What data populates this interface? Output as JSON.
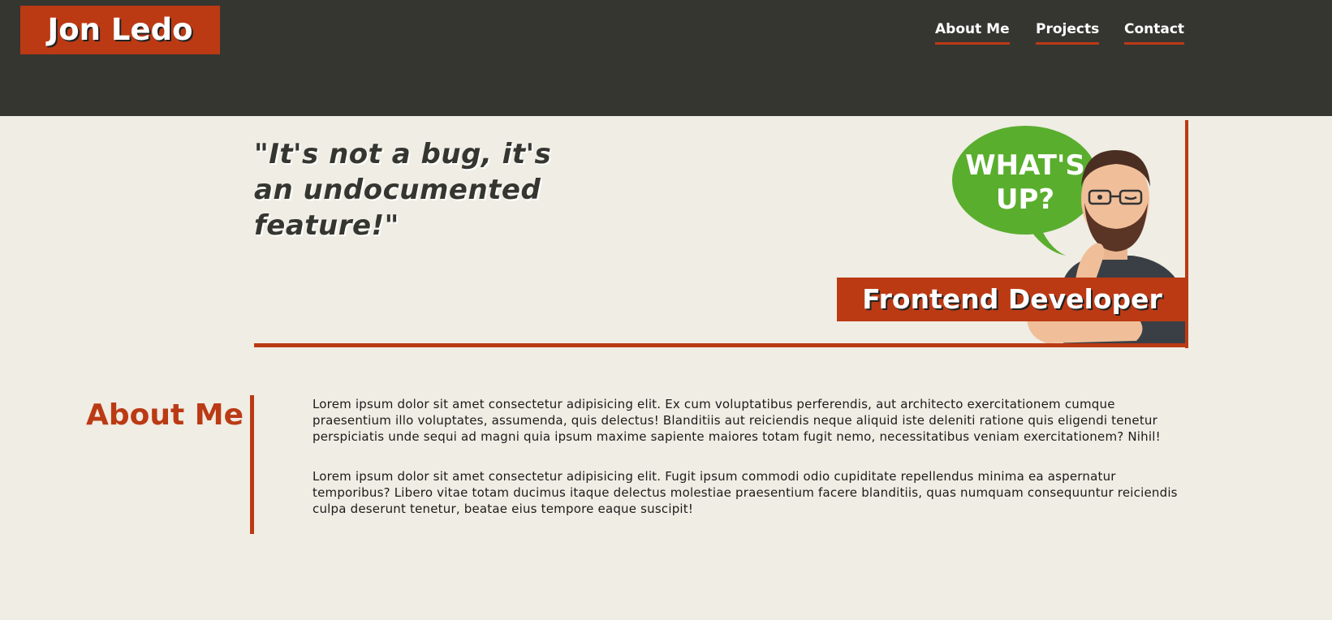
{
  "header": {
    "logo": "Jon Ledo",
    "nav": [
      {
        "label": "About Me"
      },
      {
        "label": "Projects"
      },
      {
        "label": "Contact"
      }
    ]
  },
  "hero": {
    "quote": "\"It's not a bug, it's an undocumented feature!\"",
    "avatar": {
      "speech_bubble": "WHAT'S UP?"
    },
    "role": "Frontend Developer"
  },
  "about": {
    "title": "About Me",
    "paragraphs": [
      "Lorem ipsum dolor sit amet consectetur adipisicing elit. Ex cum voluptatibus perferendis, aut architecto exercitationem cumque praesentium illo voluptates, assumenda, quis delectus! Blanditiis aut reiciendis neque aliquid iste deleniti ratione quis eligendi tenetur perspiciatis unde sequi ad magni quia ipsum maxime sapiente maiores totam fugit nemo, necessitatibus veniam exercitationem? Nihil!",
      "Lorem ipsum dolor sit amet consectetur adipisicing elit. Fugit ipsum commodi odio cupiditate repellendus minima ea aspernatur temporibus? Libero vitae totam ducimus itaque delectus molestiae praesentium facere blanditiis, quas numquam consequuntur reiciendis culpa deserunt tenetur, beatae eius tempore eaque suscipit!"
    ]
  },
  "colors": {
    "accent": "#bb3a14",
    "header_bg": "#363631",
    "page_bg": "#efede4",
    "bubble": "#5aae2e"
  }
}
